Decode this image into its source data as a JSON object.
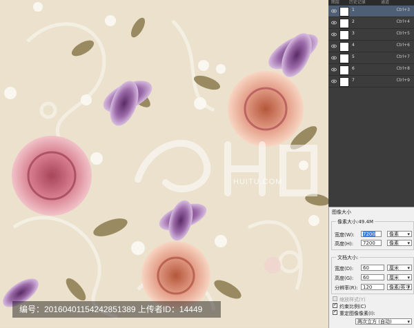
{
  "colors": {
    "background": "#e9dfca",
    "panel": "#3c3c3c",
    "selected_layer": "#4d5e75",
    "dialog": "#f0f0f0"
  },
  "panel": {
    "tabs": [
      "图层",
      "历史记录",
      "通道"
    ],
    "layers": [
      {
        "name": "1",
        "shortcut": "Ctrl+3",
        "selected": true,
        "icon": "eye-icon"
      },
      {
        "name": "2",
        "shortcut": "Ctrl+4",
        "selected": false,
        "icon": "eye-icon"
      },
      {
        "name": "3",
        "shortcut": "Ctrl+5",
        "selected": false,
        "icon": "eye-icon"
      },
      {
        "name": "4",
        "shortcut": "Ctrl+6",
        "selected": false,
        "icon": "eye-icon"
      },
      {
        "name": "5",
        "shortcut": "Ctrl+7",
        "selected": false,
        "icon": "eye-icon"
      },
      {
        "name": "6",
        "shortcut": "Ctrl+8",
        "selected": false,
        "icon": "eye-icon"
      },
      {
        "name": "7",
        "shortcut": "Ctrl+9",
        "selected": false,
        "icon": "eye-icon"
      }
    ]
  },
  "dialog": {
    "title": "图像大小",
    "pixel_group": "像素大小:49.4M",
    "width_label": "宽度(W):",
    "width_value": "7200",
    "width_unit": "像素",
    "height_label": "高度(H):",
    "height_value": "7200",
    "height_unit": "像素",
    "doc_group": "文档大小:",
    "doc_width_label": "宽度(D):",
    "doc_width_value": "60",
    "doc_width_unit": "厘米",
    "doc_height_label": "高度(G):",
    "doc_height_value": "60",
    "doc_height_unit": "厘米",
    "res_label": "分辨率(R):",
    "res_value": "120",
    "res_unit": "像素/英寸",
    "scale_styles": "缩放样式(Y)",
    "constrain": "约束比例(C)",
    "resample": "重定图像像素(I):",
    "resample_method": "两次立方 (自动)"
  },
  "watermark": {
    "text": "编号：20160401154242851389 上传者ID：14449",
    "site": "HUITU.COM"
  }
}
